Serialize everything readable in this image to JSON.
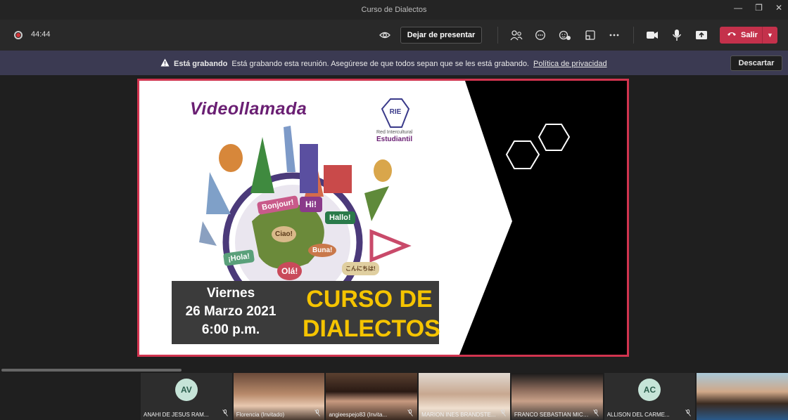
{
  "window": {
    "title": "Curso de Dialectos"
  },
  "toolbar": {
    "timer": "44:44",
    "stop_presenting_label": "Dejar de presentar",
    "leave_label": "Salir"
  },
  "banner": {
    "title": "Está grabando",
    "message": "Está grabando esta reunión. Asegúrese de que todos sepan que se les está grabando.",
    "link": "Política de privacidad",
    "dismiss_label": "Descartar"
  },
  "slide": {
    "title": "Videollamada",
    "logo_abbr": "RIE",
    "logo_line1": "Red Intercultural",
    "logo_line2": "Estudiantil",
    "bubbles": [
      "Bonjour!",
      "Hi!",
      "Hallo!",
      "Ciao!",
      "¡Hola!",
      "Buna!",
      "Olá!",
      "こんにちは!"
    ],
    "date_line1": "Viernes",
    "date_line2": "26 Marzo 2021",
    "date_line3": "6:00 p.m.",
    "course_line1": "CURSO DE",
    "course_line2": "DIALECTOS"
  },
  "participants": [
    {
      "name": "ANAHI DE JESUS RAM...",
      "initials": "AV",
      "video": false
    },
    {
      "name": "Florencia (Invitado)",
      "initials": "",
      "video": true
    },
    {
      "name": "angieespejo83 (Invita...",
      "initials": "",
      "video": true
    },
    {
      "name": "MARION INES BRANDSTE...",
      "initials": "",
      "video": true
    },
    {
      "name": "FRANCO SEBASTIAN MICC...",
      "initials": "",
      "video": true
    },
    {
      "name": "ALLISON DEL CARME...",
      "initials": "AC",
      "video": false
    },
    {
      "name": "",
      "initials": "",
      "video": true
    }
  ],
  "colors": {
    "leave_red": "#c4314b",
    "banner_bg": "#3b3a52",
    "slide_border": "#d1344f",
    "course_yellow": "#f5c400",
    "title_purple": "#6a1f73"
  },
  "icons": [
    "record-icon",
    "eye-icon",
    "people-icon",
    "chat-icon",
    "reactions-icon",
    "rooms-icon",
    "more-icon",
    "camera-icon",
    "mic-icon",
    "share-icon",
    "phone-icon",
    "warning-icon",
    "mic-off-icon"
  ]
}
